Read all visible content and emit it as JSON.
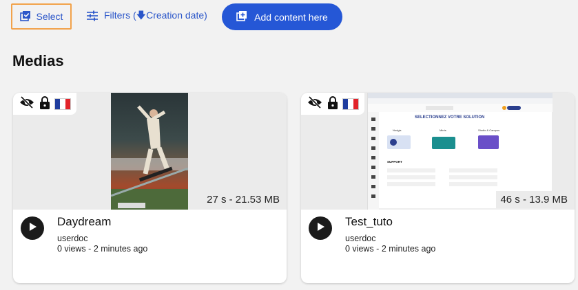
{
  "toolbar": {
    "select_label": "Select",
    "filters_label": "Filters (",
    "filters_sort": "Creation date)",
    "add_label": "Add content here"
  },
  "section": {
    "title": "Medias"
  },
  "medias": [
    {
      "title": "Daydream",
      "owner": "userdoc",
      "views": "0 views",
      "separator": "-",
      "time": "2 minutes ago",
      "duration": "27 s - 21.53 MB"
    },
    {
      "title": "Test_tuto",
      "owner": "userdoc",
      "views": "0 views",
      "separator": "-",
      "time": "2 minutes ago",
      "duration": "46 s - 13.9 MB"
    }
  ],
  "screenshot_preview": {
    "heading": "SELECTIONNEZ VOTRE SOLUTION",
    "option_1": "Nudgis",
    "option_2": "Mirris",
    "option_3": "Studio & Campus",
    "support": "SUPPORT"
  },
  "colors": {
    "accent": "#2557d6",
    "link": "#2b56c9",
    "focus": "#f2a24a"
  },
  "icons": [
    "select-checkbox-icon",
    "filters-icon",
    "arrow-down-icon",
    "add-content-icon",
    "visibility-off-icon",
    "lock-icon",
    "france-flag-icon",
    "play-icon"
  ]
}
